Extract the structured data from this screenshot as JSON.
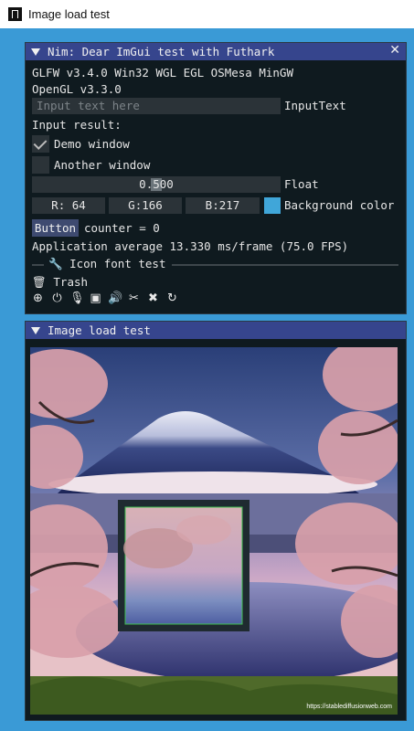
{
  "os_window": {
    "title": "Image load test"
  },
  "imgui_window": {
    "title": "Nim: Dear ImGui test with Futhark",
    "close_glyph": "✕",
    "info_line1": "GLFW v3.4.0 Win32 WGL EGL OSMesa MinGW",
    "info_line2": "OpenGL v3.3.0",
    "input_placeholder": "Input text here",
    "input_label": "InputText",
    "input_result_label": "Input result:",
    "demo_window_label": "Demo window",
    "demo_window_checked": true,
    "another_window_label": "Another window",
    "another_window_checked": false,
    "float_value": "0.500",
    "float_label": "Float",
    "color": {
      "r": "R: 64",
      "g": "G:166",
      "b": "B:217",
      "label": "Background color",
      "hex": "#40a6d9"
    },
    "button_label": "Button",
    "counter_text": "counter = 0",
    "perf_text": "Application average 13.330 ms/frame (75.0 FPS)",
    "icon_font_header": "Icon font test",
    "trash_label": "Trash",
    "icon_names": [
      "search-plus-icon",
      "power-icon",
      "microphone-icon",
      "microchip-icon",
      "volume-icon",
      "scissors-icon",
      "tools-icon",
      "rotate-icon"
    ],
    "icon_glyphs": [
      "⊕",
      "⏻",
      "🎙",
      "▣",
      "🔊",
      "✂",
      "✖",
      "↻"
    ]
  },
  "image_window": {
    "title": "Image load test",
    "watermark": "https://stablediffusionweb.com"
  }
}
